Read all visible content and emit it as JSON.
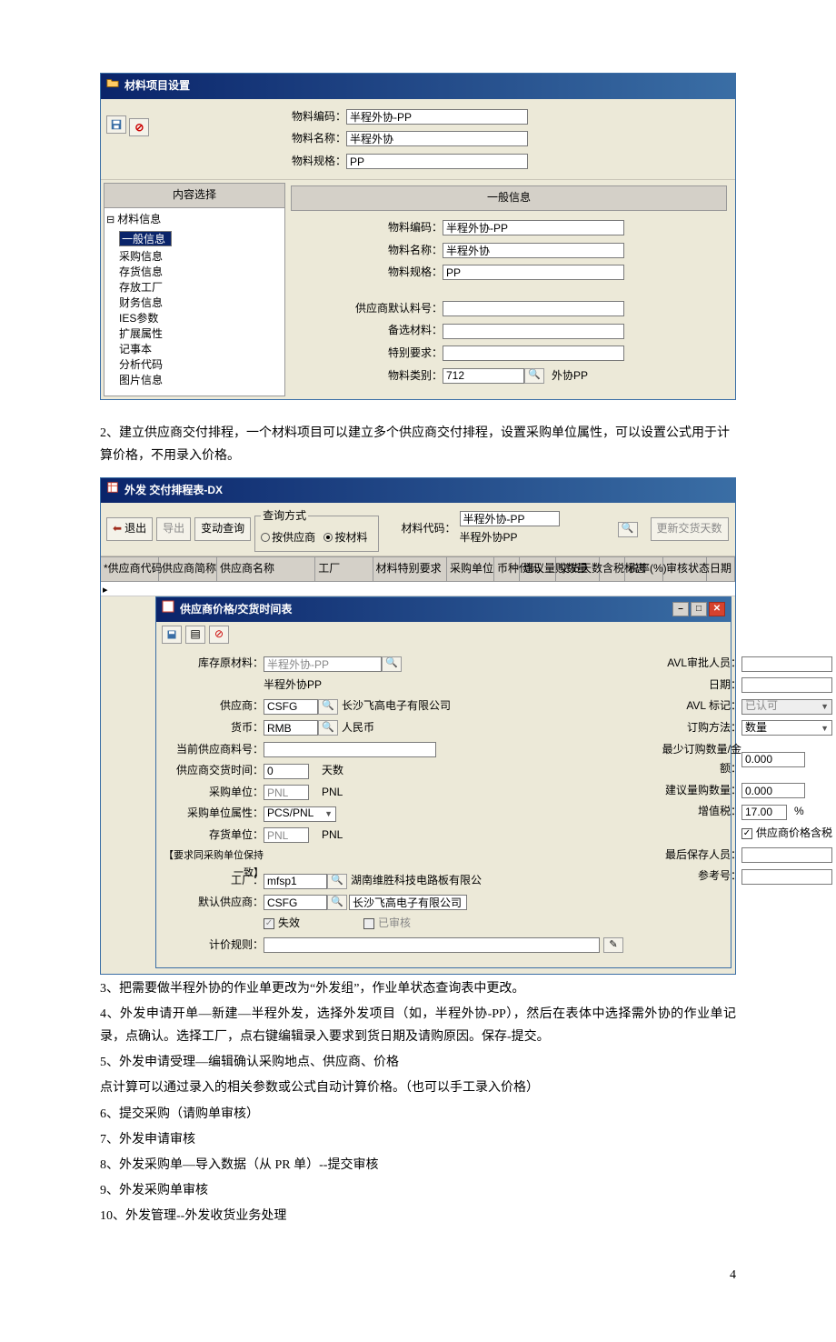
{
  "win1": {
    "title": "材料项目设置",
    "header": {
      "code_label": "物料编码：",
      "code": "半程外协-PP",
      "name_label": "物料名称：",
      "name": "半程外协",
      "spec_label": "物料规格：",
      "spec": "PP"
    },
    "left_caption": "内容选择",
    "tree": {
      "root": "材料信息",
      "items": [
        "一般信息",
        "采购信息",
        "存货信息",
        "存放工厂",
        "财务信息",
        "IES参数",
        "扩展属性",
        "记事本",
        "分析代码",
        "图片信息"
      ],
      "selected": "一般信息"
    },
    "right_caption": "一般信息",
    "form": {
      "code_label": "物料编码：",
      "code": "半程外协-PP",
      "name_label": "物料名称：",
      "name": "半程外协",
      "spec_label": "物料规格：",
      "spec": "PP",
      "supplier_default_label": "供应商默认料号：",
      "supplier_default": "",
      "alt_material_label": "备选材料：",
      "alt_material": "",
      "special_req_label": "特别要求：",
      "special_req": "",
      "category_label": "物料类别：",
      "category_code": "712",
      "category_text": "外协PP"
    }
  },
  "para2": "2、建立供应商交付排程，一个材料项目可以建立多个供应商交付排程，设置采购单位属性，可以设置公式用于计算价格，不用录入价格。",
  "win2": {
    "title": "外发 交付排程表-DX",
    "btn_exit": "退出",
    "btn_export": "导出",
    "btn_changequery": "变动查询",
    "fieldset_title": "查询方式",
    "radio_supplier": "按供应商",
    "radio_material": "按材料",
    "code_label": "材料代码：",
    "code": "半程外协-PP",
    "code_sub": "半程外协PP",
    "btn_update": "更新交货天数",
    "cols": [
      "*供应商代码",
      "供应商简称",
      "供应商名称",
      "工厂",
      "材料特别要求",
      "采购单位",
      "币种代码",
      "建议量购数量",
      "交货天数",
      "含税标志",
      "税率(%)",
      "审核状态",
      "日期"
    ]
  },
  "win3": {
    "title": "供应商价格/交货时间表",
    "L": {
      "stock_label": "库存原材料：",
      "stock": "半程外协-PP",
      "stock_sub": "半程外协PP",
      "supplier_label": "供应商：",
      "supplier": "CSFG",
      "supplier_text": "长沙飞高电子有限公司",
      "currency_label": "货币：",
      "currency": "RMB",
      "currency_text": "人民币",
      "cur_sup_no_label": "当前供应商料号：",
      "cur_sup_no": "",
      "lead_label": "供应商交货时间：",
      "lead": "0",
      "lead_unit": "天数",
      "pu_label": "采购单位：",
      "pu": "PNL",
      "pu_text": "PNL",
      "pu_attr_label": "采购单位属性：",
      "pu_attr": "PCS/PNL",
      "sku_label": "存货单位：",
      "sku": "PNL",
      "sku_text": "PNL",
      "sku_note": "【要求同采购单位保持一致】",
      "factory_label": "工厂：",
      "factory": "mfsp1",
      "factory_text": "湖南维胜科技电路板有限公",
      "def_sup_label": "默认供应商：",
      "def_sup": "CSFG",
      "def_sup_text": "长沙飞高电子有限公司",
      "invalid_label": "失效",
      "approved_label": "已审核",
      "pricerule_label": "计价规则："
    },
    "R": {
      "avl_auditor_label": "AVL审批人员：",
      "avl_auditor": "",
      "date_label": "日期：",
      "date": "",
      "avl_mark_label": "AVL 标记：",
      "avl_mark": "已认可",
      "method_label": "订购方法：",
      "method": "数量",
      "moq_label": "最少订购数量/金额：",
      "moq": "0.000",
      "suggest_qty_label": "建议量购数量：",
      "suggest_qty": "0.000",
      "vat_label": "增值税：",
      "vat": "17.00",
      "vat_pct": "%",
      "taxincl_label": "供应商价格含税",
      "lastsave_label": "最后保存人员：",
      "lastsave": "",
      "ref_label": "参考号：",
      "ref": ""
    }
  },
  "para3": [
    "3、把需要做半程外协的作业单更改为“外发组”，作业单状态查询表中更改。",
    "4、外发申请开单—新建—半程外发，选择外发项目（如，半程外协-PP），然后在表体中选择需外协的作业单记录，点确认。选择工厂，点右键编辑录入要求到货日期及请购原因。保存-提交。",
    "5、外发申请受理—编辑确认采购地点、供应商、价格",
    "点计算可以通过录入的相关参数或公式自动计算价格。（也可以手工录入价格）",
    "6、提交采购（请购单审核）",
    "7、外发申请审核",
    "8、外发采购单—导入数据（从 PR 单）--提交审核",
    "9、外发采购单审核",
    "10、外发管理--外发收货业务处理"
  ],
  "page": "4"
}
